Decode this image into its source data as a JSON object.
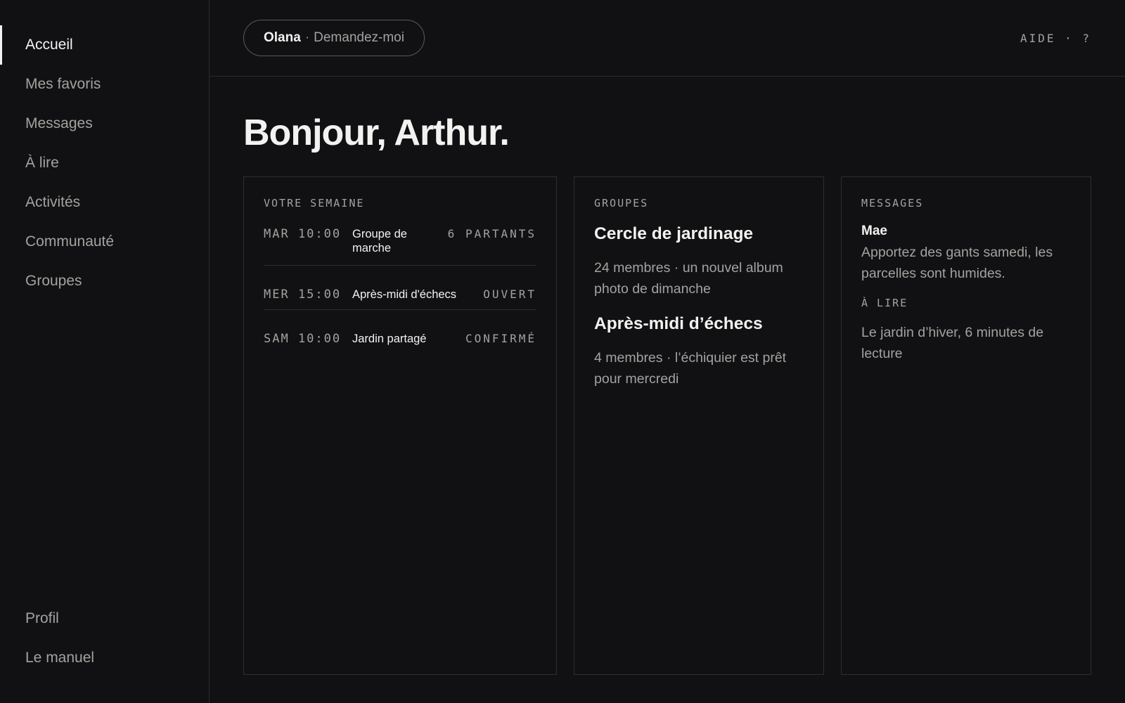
{
  "sidebar": {
    "items": [
      {
        "label": "Accueil",
        "active": true
      },
      {
        "label": "Mes favoris"
      },
      {
        "label": "Messages"
      },
      {
        "label": "À lire"
      },
      {
        "label": "Activités"
      },
      {
        "label": "Communauté"
      },
      {
        "label": "Groupes"
      }
    ],
    "bottom_items": [
      {
        "label": "Profil"
      },
      {
        "label": "Le manuel"
      }
    ]
  },
  "topbar": {
    "assistant_name": "Olana",
    "assistant_separator": "·",
    "assistant_prompt": "Demandez-moi",
    "help_label": "AIDE · ?"
  },
  "main": {
    "title": "Bonjour, Arthur."
  },
  "week": {
    "heading": "VOTRE SEMAINE",
    "rows": [
      {
        "time": "MAR 10:00",
        "title": "Groupe de marche",
        "status": "6 PARTANTS"
      },
      {
        "time": "MER 15:00",
        "title": "Après-midi d'échecs",
        "status": "OUVERT"
      },
      {
        "time": "SAM 10:00",
        "title": "Jardin partagé",
        "status": "CONFIRMÉ"
      }
    ]
  },
  "groups": {
    "heading": "GROUPES",
    "items": [
      {
        "name": "Cercle de jardinage",
        "desc": "24 membres · un nouvel album photo de dimanche"
      },
      {
        "name": "Après-midi d’échecs",
        "desc": "4 membres · l’échiquier est prêt pour mercredi"
      }
    ]
  },
  "messages": {
    "heading": "MESSAGES",
    "items": [
      {
        "from": "Mae",
        "text": "Apportez des gants samedi, les parcelles sont humides."
      }
    ],
    "read_heading": "À LIRE",
    "read_item": "Le jardin d’hiver, 6 minutes de lecture"
  },
  "colors": {
    "background": "#111113",
    "text_primary": "#f2f2f0",
    "text_muted": "#a3a29f",
    "border": "#2e2e31"
  }
}
